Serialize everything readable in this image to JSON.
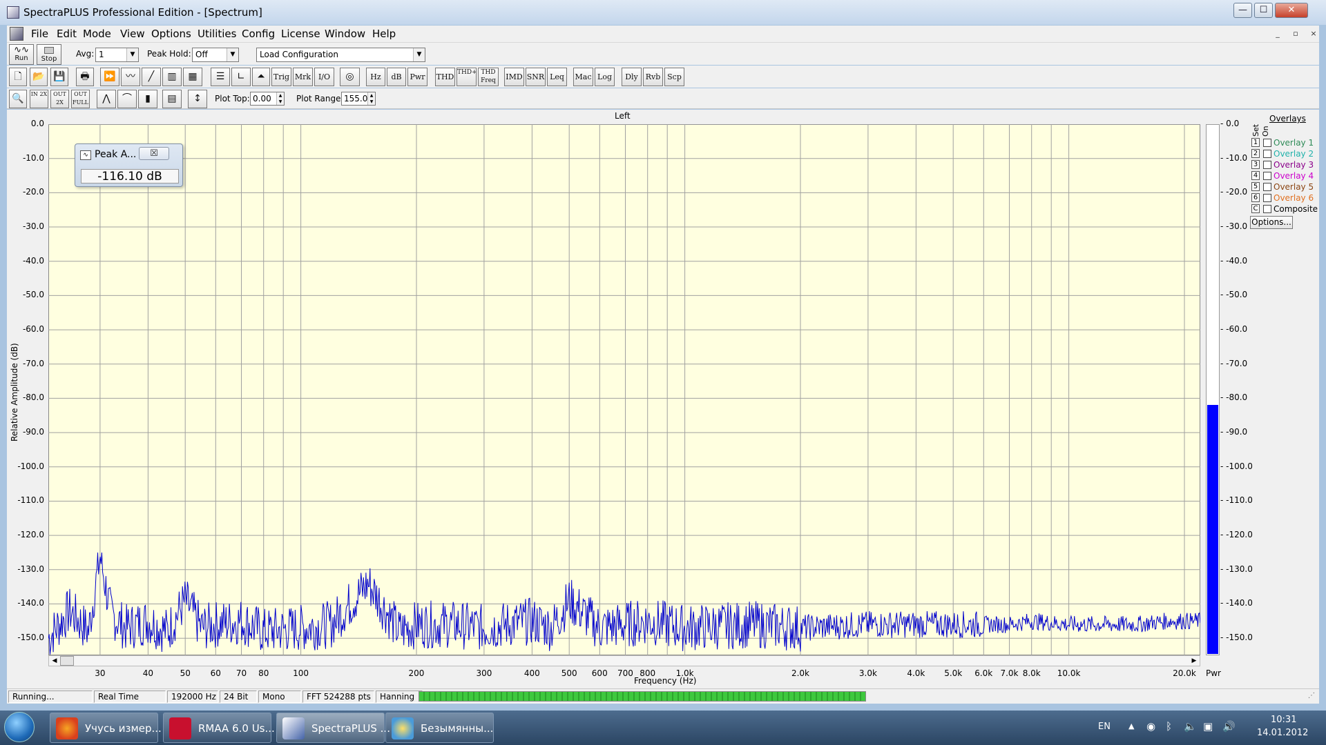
{
  "window": {
    "title": "SpectraPLUS Professional Edition - [Spectrum]",
    "min": "—",
    "max": "☐",
    "close": "✕"
  },
  "menu": [
    "File",
    "Edit",
    "Mode",
    "View",
    "Options",
    "Utilities",
    "Config",
    "License",
    "Window",
    "Help"
  ],
  "mdi_controls": [
    "_",
    "▫",
    "×"
  ],
  "toolbar1": {
    "run_label": "Run",
    "stop_label": "Stop",
    "avg_label": "Avg:",
    "avg_value": "1",
    "peak_hold_label": "Peak Hold:",
    "peak_hold_value": "Off",
    "config_value": "Load Configuration"
  },
  "toolbar2": {
    "icons": [
      "new-icon",
      "open-icon",
      "save-icon",
      "print-icon",
      "fast-forward-icon",
      "waveform-icon",
      "line-icon",
      "spectrum-icon",
      "spectrogram-icon"
    ],
    "buttons": [
      "Trig",
      "Mrk",
      "I/O",
      "Hz",
      "dB",
      "Pwr",
      "THD",
      "THD+N",
      "THD Freq",
      "IMD",
      "SNR",
      "Leq",
      "Mac",
      "Log",
      "Dly",
      "Rvb",
      "Scp"
    ]
  },
  "toolbar3": {
    "zoom_buttons": [
      "IN 2X",
      "OUT 2X",
      "OUT FULL"
    ],
    "plot_top_label": "Plot Top:",
    "plot_top_value": "0.00",
    "plot_range_label": "Plot Range:",
    "plot_range_value": "155.0"
  },
  "plot": {
    "channel": "Left",
    "ylabel": "Relative Amplitude (dB)",
    "xlabel": "Frequency (Hz)",
    "pwr_label": "Pwr",
    "y_ticks": [
      "0.0",
      "-10.0",
      "-20.0",
      "-30.0",
      "-40.0",
      "-50.0",
      "-60.0",
      "-70.0",
      "-80.0",
      "-90.0",
      "-100.0",
      "-110.0",
      "-120.0",
      "-130.0",
      "-140.0",
      "-150.0"
    ],
    "x_ticks": [
      "30",
      "40",
      "50",
      "60",
      "70",
      "80",
      "100",
      "200",
      "300",
      "400",
      "500",
      "600",
      "700",
      "800",
      "1.0k",
      "2.0k",
      "3.0k",
      "4.0k",
      "5.0k",
      "6.0k",
      "7.0k",
      "8.0k",
      "10.0k",
      "20.0k"
    ],
    "power_level_db": -82,
    "trace_color": "#0000cc",
    "background_color": "#ffffe0",
    "grid": true,
    "scale": "log"
  },
  "chart_data": {
    "type": "line",
    "title": "Left",
    "xlabel": "Frequency (Hz)",
    "ylabel": "Relative Amplitude (dB)",
    "x_scale": "log",
    "xlim": [
      22,
      22000
    ],
    "ylim": [
      -155,
      0
    ],
    "series": [
      {
        "x": [
          22,
          25,
          28,
          30,
          32,
          35,
          40,
          45,
          50,
          55,
          60,
          70,
          80,
          100,
          120,
          150,
          180,
          200,
          250,
          300,
          400,
          450,
          500,
          600,
          700,
          800,
          1000,
          1500,
          2000,
          3000,
          4000,
          5000,
          6000,
          7000,
          8000,
          10000,
          12000,
          15000,
          18000,
          20000
        ],
        "y": [
          -150,
          -142,
          -148,
          -126,
          -143,
          -147,
          -145,
          -148,
          -139,
          -147,
          -146,
          -145,
          -148,
          -147,
          -146,
          -134,
          -148,
          -146,
          -146,
          -147,
          -145,
          -147,
          -139,
          -147,
          -146,
          -145,
          -147,
          -146,
          -147,
          -146,
          -146,
          -146,
          -146,
          -146,
          -145,
          -146,
          -146,
          -146,
          -145,
          -145
        ]
      }
    ]
  },
  "peak_window": {
    "title": "Peak A...",
    "close": "☒",
    "value": "-116.10 dB"
  },
  "overlays": {
    "title": "Overlays",
    "set_label": "Set",
    "on_label": "On",
    "items": [
      {
        "num": "1",
        "label": "Overlay 1",
        "color": "#2e8b57"
      },
      {
        "num": "2",
        "label": "Overlay 2",
        "color": "#20b2aa"
      },
      {
        "num": "3",
        "label": "Overlay 3",
        "color": "#8b008b"
      },
      {
        "num": "4",
        "label": "Overlay 4",
        "color": "#cc00cc"
      },
      {
        "num": "5",
        "label": "Overlay 5",
        "color": "#8b4513"
      },
      {
        "num": "6",
        "label": "Overlay 6",
        "color": "#e07020"
      },
      {
        "num": "C",
        "label": "Composite",
        "color": "#000000"
      }
    ],
    "options_button": "Options..."
  },
  "status": {
    "state": "Running...",
    "mode": "Real Time",
    "rate": "192000 Hz",
    "bits": "24 Bit",
    "channels": "Mono",
    "fft": "FFT 524288 pts",
    "window": "Hanning",
    "progress": 1.0
  },
  "taskbar": {
    "tasks": [
      "Учусь измер...",
      "RMAA 6.0 Us...",
      "SpectraPLUS ...",
      "Безымянны..."
    ],
    "lang": "EN",
    "time": "10:31",
    "date": "14.01.2012"
  }
}
